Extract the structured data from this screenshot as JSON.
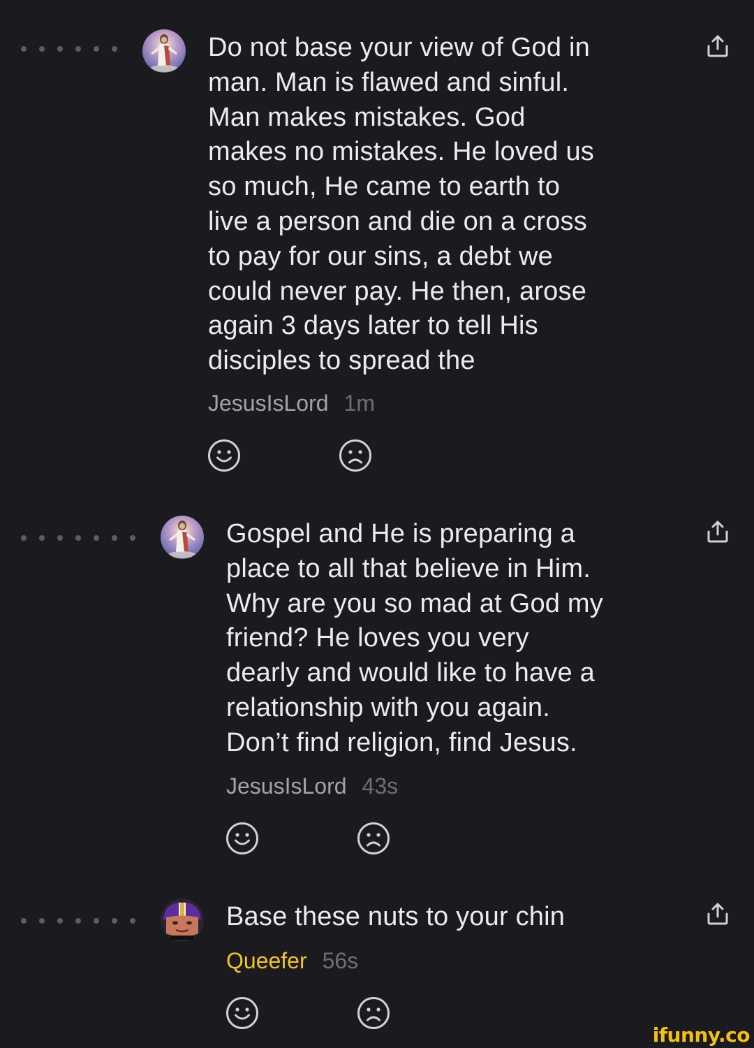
{
  "comments": [
    {
      "text": "Do not base your view of God in\nman. Man is flawed and sinful.\nMan makes mistakes. God\nmakes no mistakes. He loved us\nso much, He came to earth to\nlive a person and die on a cross\nto pay for our sins, a debt we\ncould never pay. He then, arose\nagain 3 days later to tell His\ndisciples to spread the",
      "username": "JesusIsLord",
      "time": "1m",
      "avatar": "jesus-avatar",
      "username_color": "#a3a3a8"
    },
    {
      "text": "Gospel and He is preparing a\nplace to all that believe in Him.\nWhy are you so mad at God my\nfriend? He loves you very\ndearly and would like to have a\nrelationship with you again.\nDon’t find religion, find Jesus.",
      "username": "JesusIsLord",
      "time": "43s",
      "avatar": "jesus-avatar",
      "username_color": "#a3a3a8"
    },
    {
      "text": "Base these nuts to your chin",
      "username": "Queefer",
      "time": "56s",
      "avatar": "football-helmet-avatar",
      "username_color": "#f2c230"
    }
  ],
  "icons": {
    "reaction_positive": "smiley-face-icon",
    "reaction_negative": "frowning-face-icon",
    "share": "share-upload-icon"
  },
  "colors": {
    "background": "#1b1b1f",
    "text": "#ececee",
    "muted": "#6e6e74",
    "accent": "#f2c230"
  },
  "watermark": "ifunny.co"
}
